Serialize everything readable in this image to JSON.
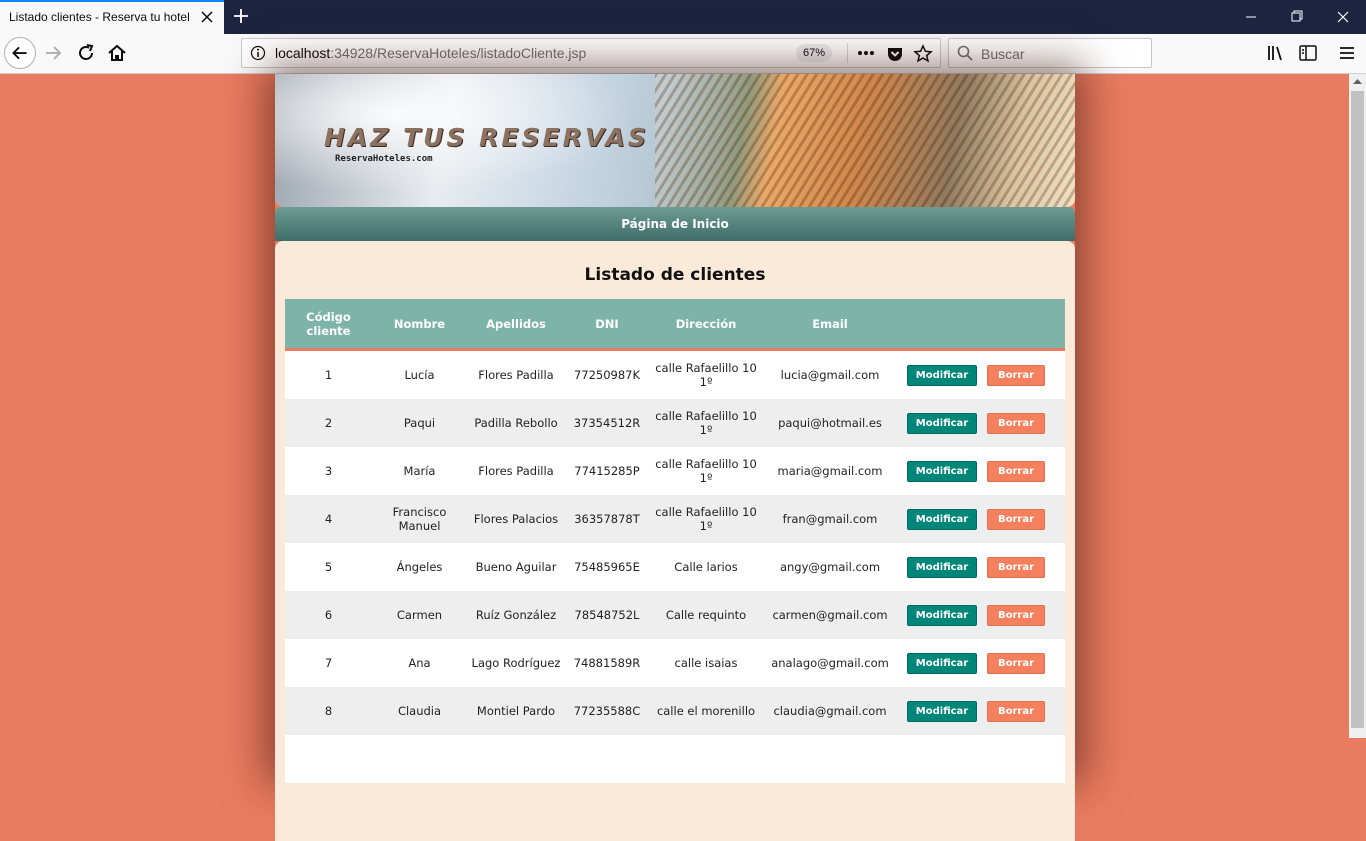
{
  "browser": {
    "tab_title": "Listado clientes - Reserva tu hotel",
    "url_host": "localhost",
    "url_rest": ":34928/ReservaHoteles/listadoCliente.jsp",
    "zoom": "67%",
    "search_placeholder": "Buscar"
  },
  "banner": {
    "title": "HAZ TUS RESERVAS",
    "subtitle": "ReservaHoteles.com"
  },
  "nav": {
    "home": "Página de Inicio"
  },
  "page": {
    "heading": "Listado de clientes"
  },
  "table": {
    "headers": [
      "Código cliente",
      "Nombre",
      "Apellidos",
      "DNI",
      "Dirección",
      "Email"
    ],
    "modify_label": "Modificar",
    "delete_label": "Borrar",
    "rows": [
      [
        "1",
        "Lucía",
        "Flores Padilla",
        "77250987K",
        "calle Rafaelillo 10 1º",
        "lucia@gmail.com"
      ],
      [
        "2",
        "Paqui",
        "Padilla Rebollo",
        "37354512R",
        "calle Rafaelillo 10 1º",
        "paqui@hotmail.es"
      ],
      [
        "3",
        "María",
        "Flores Padilla",
        "77415285P",
        "calle Rafaelillo 10 1º",
        "maria@gmail.com"
      ],
      [
        "4",
        "Francisco Manuel",
        "Flores Palacios",
        "36357878T",
        "calle Rafaelillo 10 1º",
        "fran@gmail.com"
      ],
      [
        "5",
        "Ángeles",
        "Bueno Aguilar",
        "75485965E",
        "Calle larios",
        "angy@gmail.com"
      ],
      [
        "6",
        "Carmen",
        "Ruíz González",
        "78548752L",
        "Calle requinto",
        "carmen@gmail.com"
      ],
      [
        "7",
        "Ana",
        "Lago Rodríguez",
        "74881589R",
        "calle isaias",
        "analago@gmail.com"
      ],
      [
        "8",
        "Claudia",
        "Montiel Pardo",
        "77235588C",
        "calle el morenillo",
        "claudia@gmail.com"
      ]
    ]
  }
}
